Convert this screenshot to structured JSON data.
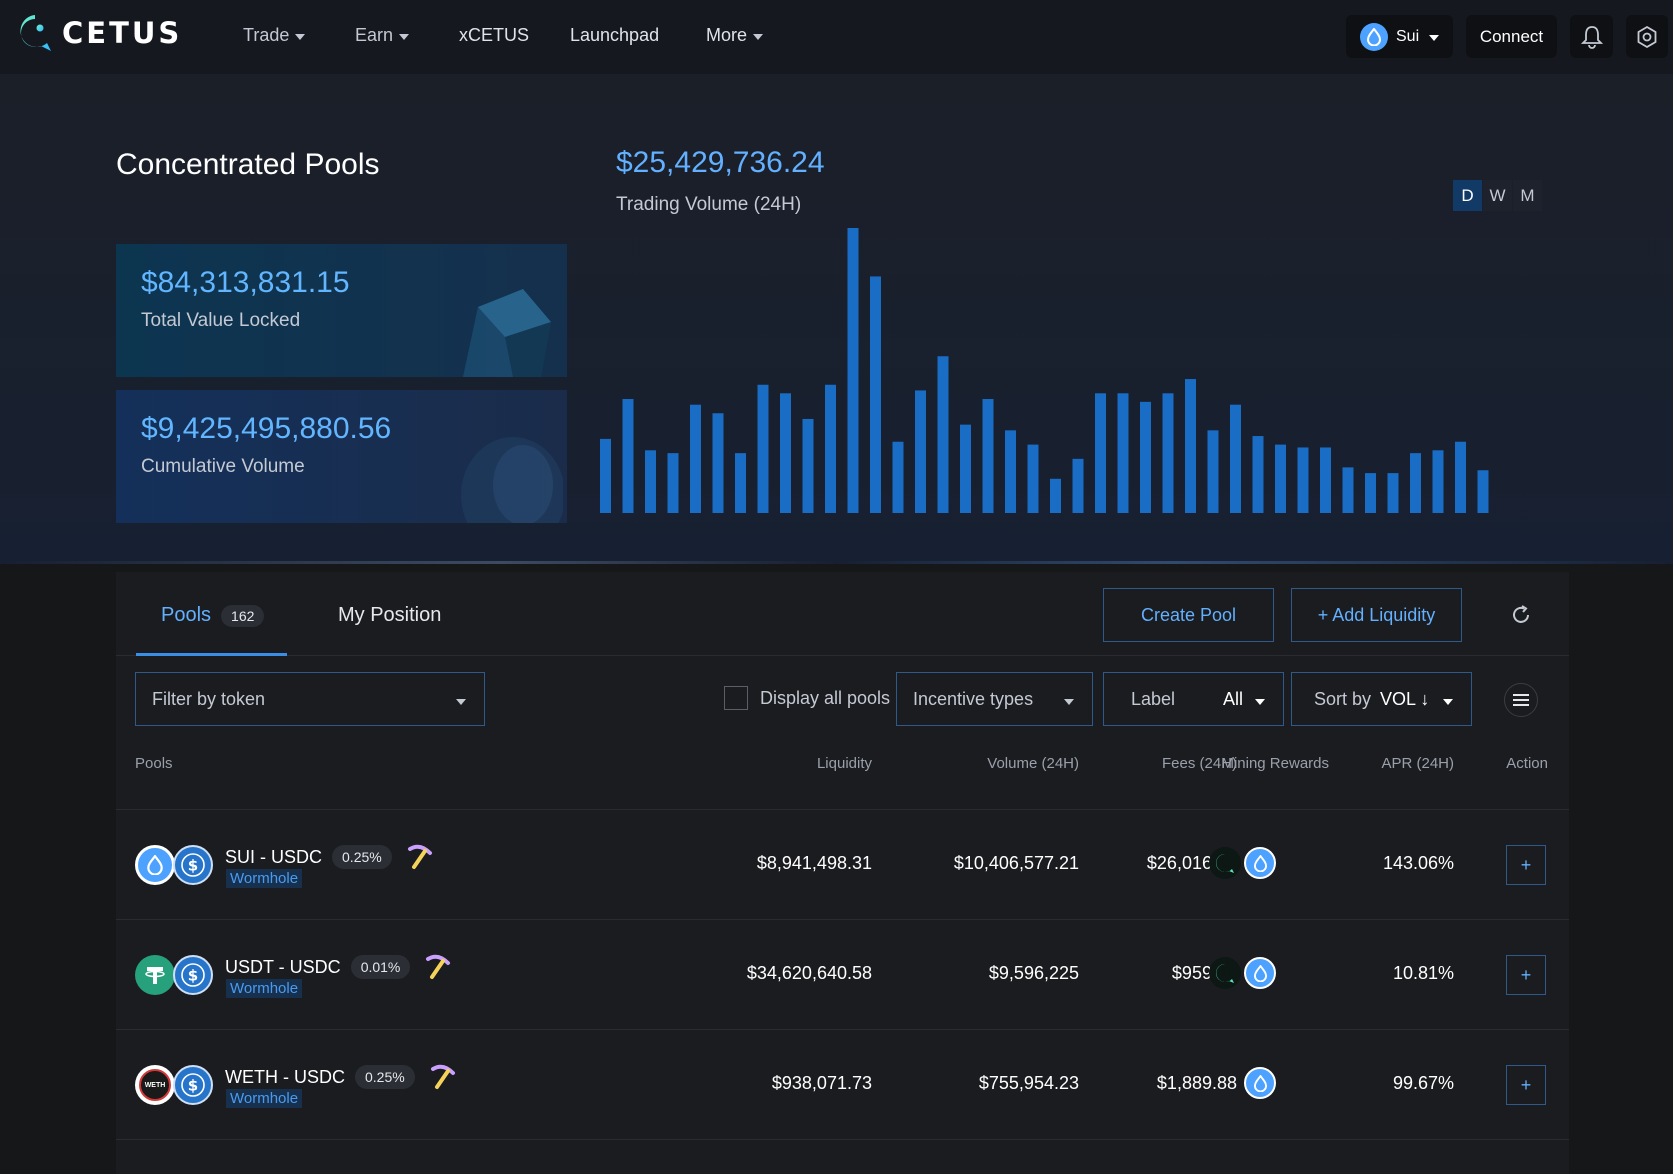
{
  "nav": {
    "brand": "CETUS",
    "items": [
      {
        "label": "Trade",
        "dropdown": true
      },
      {
        "label": "Earn",
        "dropdown": true
      },
      {
        "label": "xCETUS",
        "dropdown": false
      },
      {
        "label": "Launchpad",
        "dropdown": false
      },
      {
        "label": "More",
        "dropdown": true
      }
    ],
    "network": "Sui",
    "connect": "Connect",
    "icons": [
      "bell-icon",
      "settings-icon"
    ]
  },
  "hero": {
    "title": "Concentrated Pools",
    "volume_value": "$25,429,736.24",
    "volume_label": "Trading Volume (24H)",
    "tvl_value": "$84,313,831.15",
    "tvl_label": "Total Value Locked",
    "cum_value": "$9,425,495,880.56",
    "cum_label": "Cumulative Volume",
    "ranges": [
      "D",
      "W",
      "M"
    ],
    "active_range": "D"
  },
  "chart_data": {
    "type": "bar",
    "title": "",
    "xlabel": "",
    "ylabel": "",
    "bar_color": "#1a6dc4",
    "ylim": [
      0,
      100
    ],
    "values": [
      26,
      40,
      22,
      21,
      38,
      35,
      21,
      45,
      42,
      33,
      45,
      100,
      83,
      25,
      43,
      55,
      31,
      40,
      29,
      24,
      12,
      19,
      42,
      42,
      39,
      42,
      47,
      29,
      38,
      27,
      24,
      23,
      23,
      16,
      14,
      14,
      21,
      22,
      25,
      15
    ]
  },
  "tabs": {
    "pools_label": "Pools",
    "pools_count": "162",
    "position_label": "My Position",
    "create_pool": "Create Pool",
    "add_liquidity": "+ Add Liquidity"
  },
  "filters": {
    "token_placeholder": "Filter by token",
    "display_all": "Display all pools",
    "incentive": "Incentive types",
    "label_prefix": "Label",
    "label_value": "All",
    "sort_prefix": "Sort by",
    "sort_value": "VOL ↓"
  },
  "table": {
    "headers": {
      "pools": "Pools",
      "liquidity": "Liquidity",
      "volume": "Volume (24H)",
      "fees": "Fees (24H)",
      "rewards": "Mining Rewards",
      "apr": "APR (24H)",
      "action": "Action"
    },
    "rows": [
      {
        "pair": "SUI - USDC",
        "fee": "0.25%",
        "tag": "Wormhole",
        "liquidity": "$8,941,498.31",
        "volume": "$10,406,577.21",
        "fees": "$26,016.44",
        "apr": "143.06%",
        "token_a": "sui-icon",
        "token_b": "usdc-icon",
        "rewards": [
          "cetus-icon",
          "sui-icon"
        ],
        "action": "+"
      },
      {
        "pair": "USDT - USDC",
        "fee": "0.01%",
        "tag": "Wormhole",
        "liquidity": "$34,620,640.58",
        "volume": "$9,596,225",
        "fees": "$959.62",
        "apr": "10.81%",
        "token_a": "usdt-icon",
        "token_b": "usdc-icon",
        "rewards": [
          "cetus-icon",
          "sui-icon"
        ],
        "action": "+"
      },
      {
        "pair": "WETH - USDC",
        "fee": "0.25%",
        "tag": "Wormhole",
        "liquidity": "$938,071.73",
        "volume": "$755,954.23",
        "fees": "$1,889.88",
        "apr": "99.67%",
        "token_a": "weth-icon",
        "token_b": "usdc-icon",
        "token_a_text": "WETH",
        "rewards": [
          "sui-icon"
        ],
        "action": "+"
      }
    ]
  }
}
